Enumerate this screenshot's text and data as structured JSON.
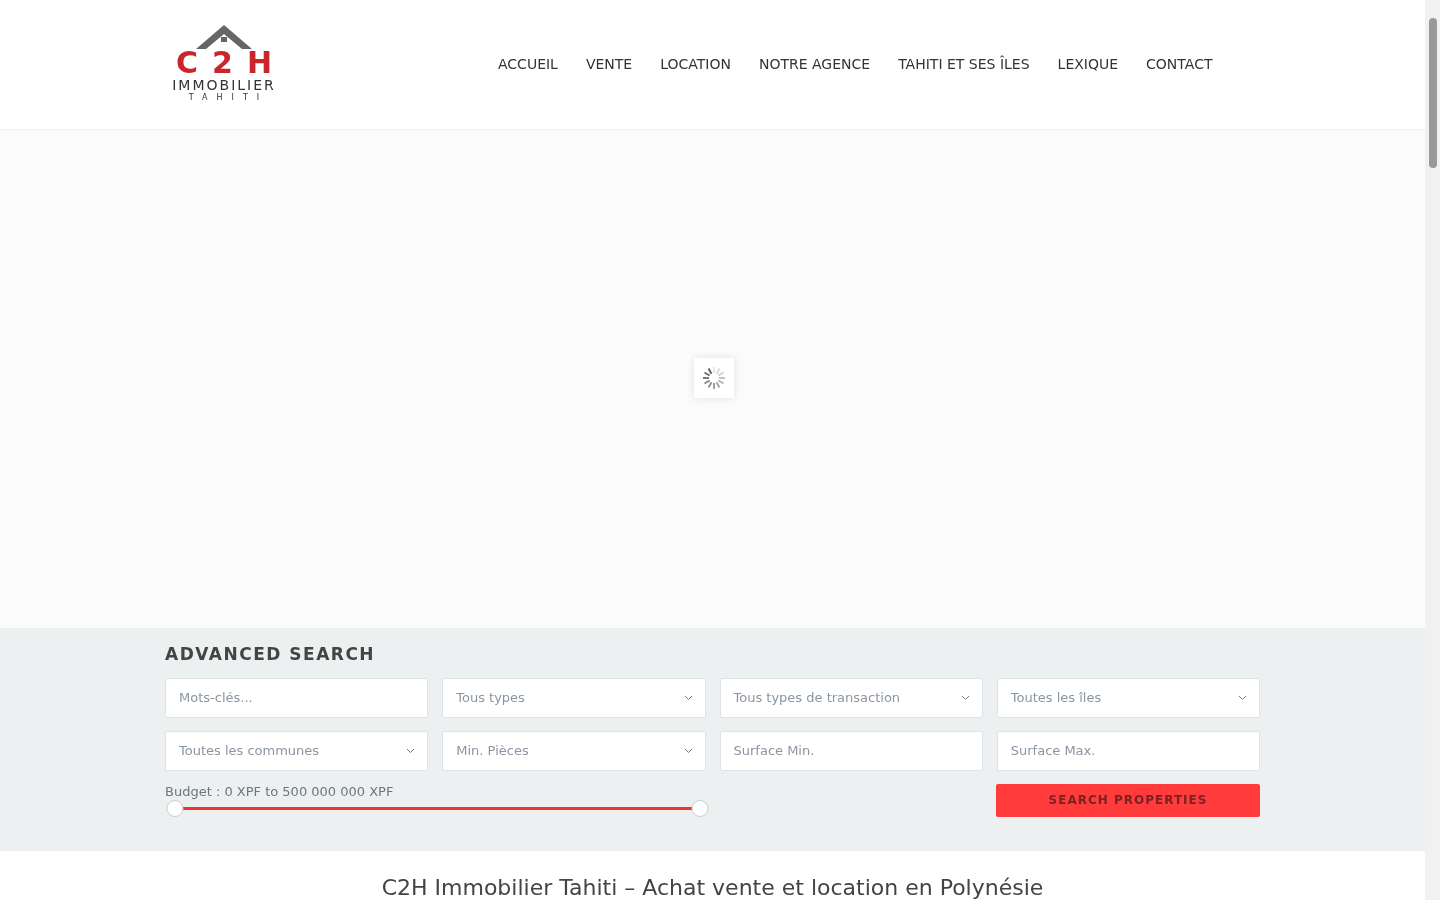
{
  "logo": {
    "mark": "C2H",
    "name": "IMMOBILIER",
    "place": "TAHITI"
  },
  "nav": [
    {
      "label": "ACCUEIL"
    },
    {
      "label": "VENTE"
    },
    {
      "label": "LOCATION"
    },
    {
      "label": "NOTRE AGENCE"
    },
    {
      "label": "TAHITI ET SES ÎLES"
    },
    {
      "label": "LEXIQUE"
    },
    {
      "label": "CONTACT"
    }
  ],
  "search": {
    "title": "ADVANCED SEARCH",
    "fields": [
      {
        "kind": "text",
        "placeholder": "Mots-clés..."
      },
      {
        "kind": "select",
        "value": "Tous types"
      },
      {
        "kind": "select",
        "value": "Tous types de transaction"
      },
      {
        "kind": "select",
        "value": "Toutes les îles"
      },
      {
        "kind": "select",
        "value": "Toutes les communes"
      },
      {
        "kind": "select",
        "value": "Min. Pièces"
      },
      {
        "kind": "text",
        "placeholder": "Surface Min."
      },
      {
        "kind": "text",
        "placeholder": "Surface Max."
      }
    ],
    "budget": {
      "label": "Budget : 0 XPF to 500 000 000 XPF",
      "handles": [
        {
          "level": 0
        },
        {
          "level": 1
        }
      ]
    },
    "button": "SEARCH PROPERTIES"
  },
  "heading": "C2H Immobilier Tahiti – Achat vente et location en Polynésie"
}
